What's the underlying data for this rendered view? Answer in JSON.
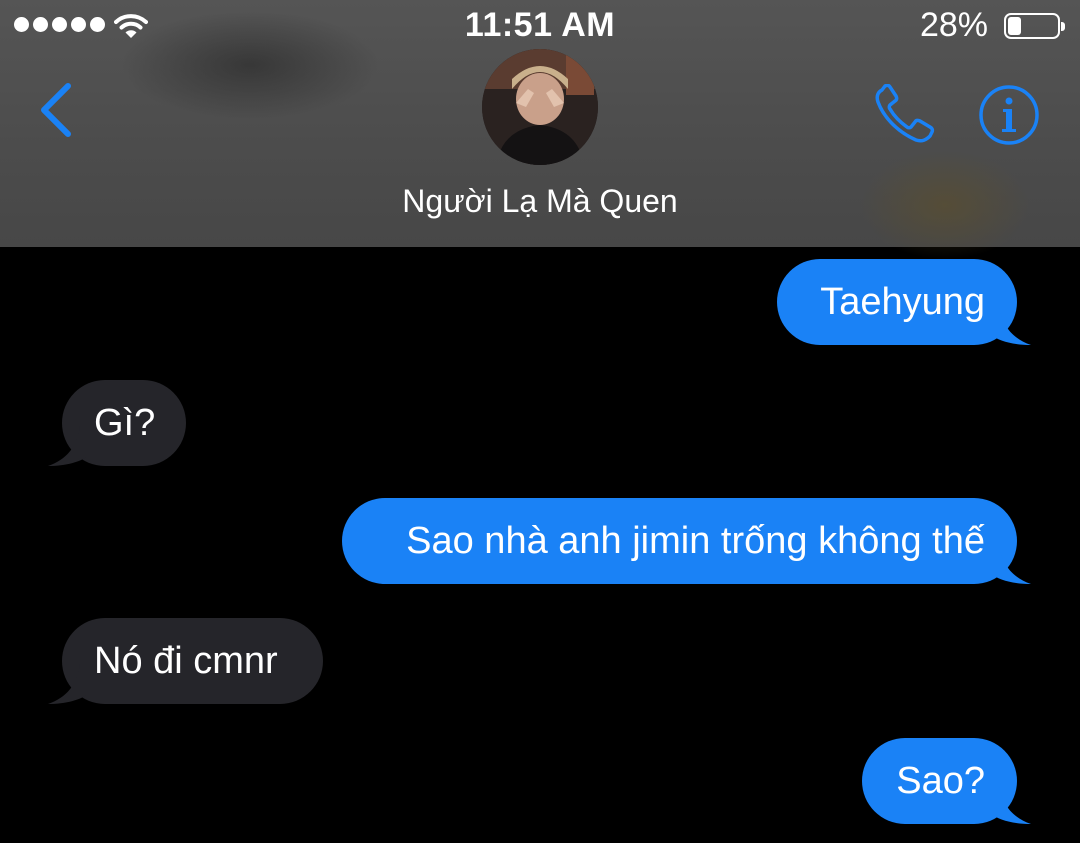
{
  "status_bar": {
    "time": "11:51 AM",
    "battery_percent_label": "28%",
    "battery_level": 0.28,
    "signal_dots": 5
  },
  "header": {
    "contact_name": "Người Lạ Mà Quen",
    "back_icon": "chevron-left-icon",
    "call_icon": "phone-icon",
    "info_icon": "info-icon"
  },
  "colors": {
    "accent": "#1a82f6",
    "sent_bubble": "#1a82f6",
    "received_bubble": "#25252a",
    "header_bg": "#4f4f4f",
    "background": "#000000"
  },
  "messages": [
    {
      "direction": "sent",
      "text": "Taehyung"
    },
    {
      "direction": "received",
      "text": "Gì?"
    },
    {
      "direction": "sent",
      "text": "Sao nhà anh jimin trống không thế"
    },
    {
      "direction": "received",
      "text": "Nó đi cmnr"
    },
    {
      "direction": "sent",
      "text": "Sao?"
    }
  ]
}
